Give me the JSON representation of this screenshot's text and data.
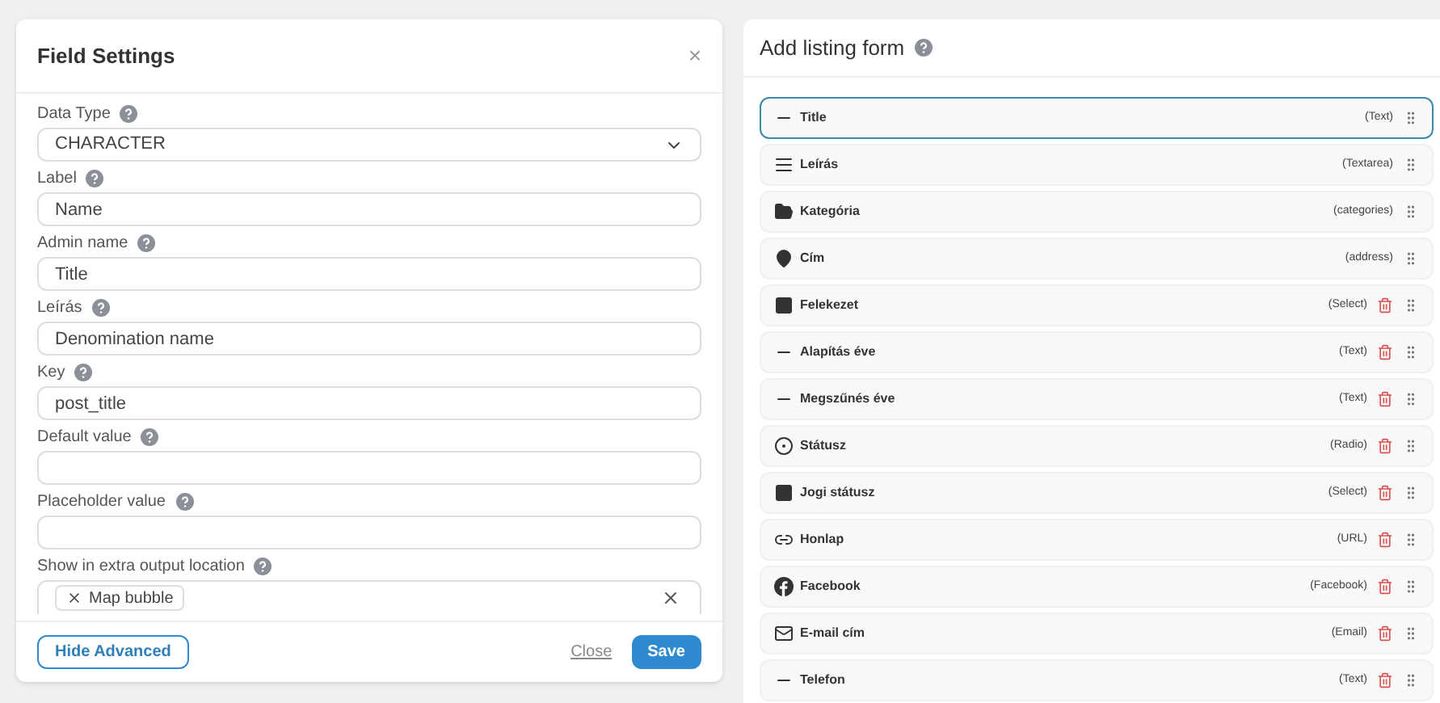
{
  "settings": {
    "title": "Field Settings",
    "close_icon": "×",
    "fields": [
      {
        "kind": "select",
        "label": "Data Type",
        "value": "CHARACTER"
      },
      {
        "kind": "input",
        "label": "Label",
        "value": "Name"
      },
      {
        "kind": "input",
        "label": "Admin name",
        "value": "Title"
      },
      {
        "kind": "input",
        "label": "Leírás",
        "value": "Denomination name"
      },
      {
        "kind": "input",
        "label": "Key",
        "value": "post_title"
      },
      {
        "kind": "input",
        "label": "Default value"
      },
      {
        "kind": "input",
        "label": "Placeholder value"
      },
      {
        "kind": "tags",
        "label": "Show in extra output location",
        "tags": [
          "Map bubble"
        ]
      }
    ],
    "buttons": {
      "advanced": "Hide Advanced",
      "close": "Close",
      "save": "Save"
    }
  },
  "form": {
    "title": "Add listing form",
    "items": [
      {
        "kind": "dash",
        "label": "Title",
        "type": "(Text)",
        "deletable": false,
        "selected": true
      },
      {
        "kind": "lines",
        "label": "Leírás",
        "type": "(Textarea)",
        "deletable": false,
        "selected": false
      },
      {
        "kind": "folder",
        "label": "Kategória",
        "type": "(categories)",
        "deletable": false,
        "selected": false
      },
      {
        "kind": "pin",
        "label": "Cím",
        "type": "(address)",
        "deletable": false,
        "selected": false
      },
      {
        "kind": "square",
        "label": "Felekezet",
        "type": "(Select)",
        "deletable": true,
        "selected": false
      },
      {
        "kind": "dash",
        "label": "Alapítás éve",
        "type": "(Text)",
        "deletable": true,
        "selected": false
      },
      {
        "kind": "dash",
        "label": "Megszűnés éve",
        "type": "(Text)",
        "deletable": true,
        "selected": false
      },
      {
        "kind": "radio",
        "label": "Státusz",
        "type": "(Radio)",
        "deletable": true,
        "selected": false
      },
      {
        "kind": "square",
        "label": "Jogi státusz",
        "type": "(Select)",
        "deletable": true,
        "selected": false
      },
      {
        "kind": "link",
        "label": "Honlap",
        "type": "(URL)",
        "deletable": true,
        "selected": false
      },
      {
        "kind": "facebook",
        "label": "Facebook",
        "type": "(Facebook)",
        "deletable": true,
        "selected": false
      },
      {
        "kind": "mail",
        "label": "E-mail cím",
        "type": "(Email)",
        "deletable": true,
        "selected": false
      },
      {
        "kind": "dash",
        "label": "Telefon",
        "type": "(Text)",
        "deletable": true,
        "selected": false
      }
    ]
  }
}
